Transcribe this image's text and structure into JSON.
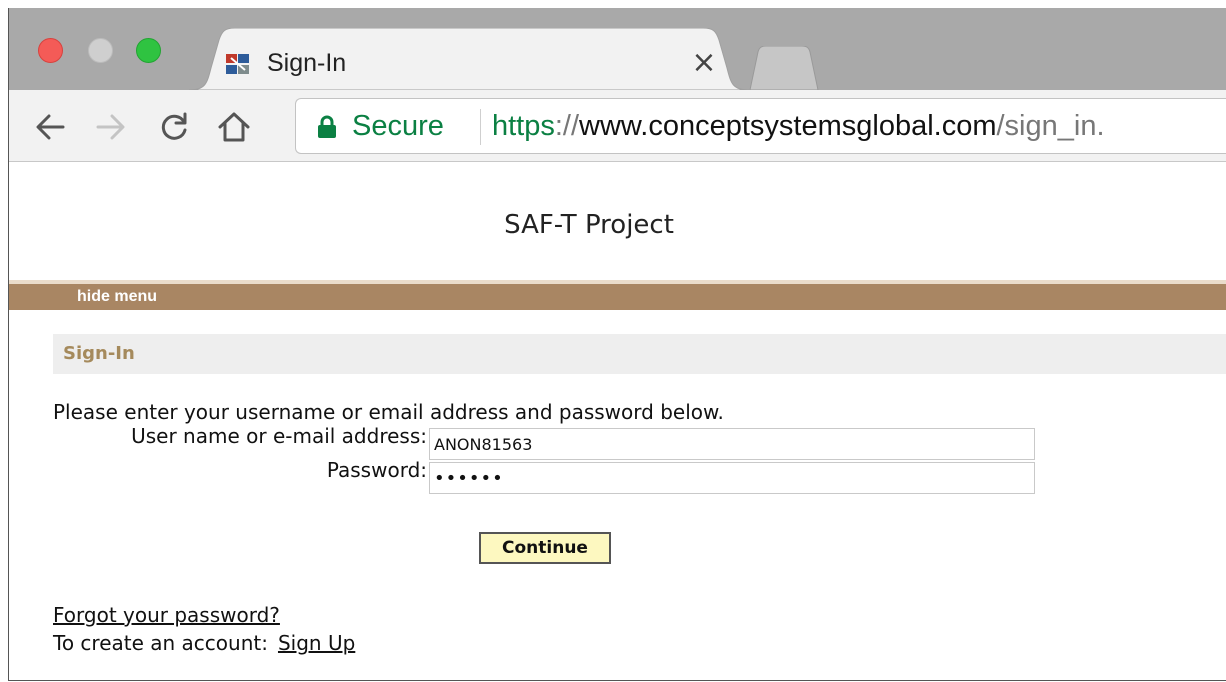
{
  "browser": {
    "tab_title": "Sign-In",
    "tab_close_glyph": "×",
    "omnibox": {
      "secure_label": "Secure",
      "url_scheme": "https",
      "url_separator": "://",
      "url_host": "www.conceptsystemsglobal.com",
      "url_path": "/sign_in."
    },
    "icons": [
      "back-arrow-icon",
      "forward-arrow-icon",
      "reload-icon",
      "home-icon",
      "lock-icon",
      "favicon-icon",
      "close-icon"
    ],
    "colors": {
      "secure_green": "#0b8043",
      "close_red": "#f45b57",
      "max_green": "#2fc341"
    }
  },
  "page": {
    "project_title": "SAF-T Project",
    "menu_toggle": "hide menu",
    "section_title": "Sign-In",
    "intro_text": "Please enter your username or email address and password below.",
    "username_label": "User name or e-mail address:",
    "username_value": "ANON81563",
    "password_label": "Password:",
    "password_masked": "••••••",
    "continue_label": "Continue",
    "forgot_link": "Forgot your password?",
    "create_text": "To create an account:",
    "signup_link": "Sign Up",
    "colors": {
      "menu_bar": "#a98663",
      "section_title": "#a58a5c",
      "continue_bg": "#fdf8c0"
    }
  }
}
